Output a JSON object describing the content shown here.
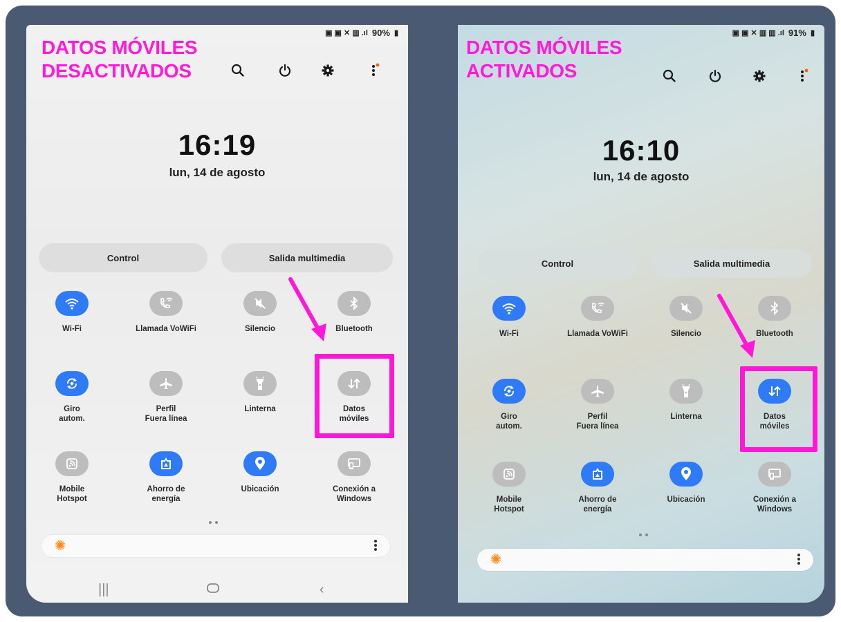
{
  "frame_color": "#4a5a73",
  "accent_color": "#ff18d6",
  "toggle_on_color": "#2f7af6",
  "toggle_off_color": "#bdbdbd",
  "left": {
    "caption_line1": "DATOS MÓVILES",
    "caption_line2": "DESACTIVADOS",
    "battery": "90%",
    "time": "16:19",
    "date": "lun, 14 de agosto",
    "control_label": "Control",
    "media_label": "Salida multimedia",
    "tiles": [
      {
        "label1": "Wi-Fi",
        "label2": "",
        "icon": "wifi-icon",
        "on": true
      },
      {
        "label1": "Llamada VoWiFi",
        "label2": "",
        "icon": "phone-wifi-icon",
        "on": false
      },
      {
        "label1": "Silencio",
        "label2": "",
        "icon": "mute-icon",
        "on": false
      },
      {
        "label1": "Bluetooth",
        "label2": "",
        "icon": "bluetooth-icon",
        "on": false
      },
      {
        "label1": "Giro",
        "label2": "autom.",
        "icon": "rotate-icon",
        "on": true
      },
      {
        "label1": "Perfil",
        "label2": "Fuera línea",
        "icon": "airplane-icon",
        "on": false
      },
      {
        "label1": "Linterna",
        "label2": "",
        "icon": "flashlight-icon",
        "on": false
      },
      {
        "label1": "Datos",
        "label2": "móviles",
        "icon": "mobile-data-icon",
        "on": false
      },
      {
        "label1": "Mobile",
        "label2": "Hotspot",
        "icon": "hotspot-icon",
        "on": false
      },
      {
        "label1": "Ahorro de",
        "label2": "energía",
        "icon": "battery-saver-icon",
        "on": true
      },
      {
        "label1": "Ubicación",
        "label2": "",
        "icon": "location-icon",
        "on": true
      },
      {
        "label1": "Conexión a",
        "label2": "Windows",
        "icon": "windows-link-icon",
        "on": false
      }
    ]
  },
  "right": {
    "caption_line1": "DATOS MÓVILES",
    "caption_line2": "ACTIVADOS",
    "battery": "91%",
    "time": "16:10",
    "date": "lun, 14 de agosto",
    "control_label": "Control",
    "media_label": "Salida multimedia",
    "tiles": [
      {
        "label1": "Wi-Fi",
        "label2": "",
        "icon": "wifi-icon",
        "on": true
      },
      {
        "label1": "Llamada VoWiFi",
        "label2": "",
        "icon": "phone-wifi-icon",
        "on": false
      },
      {
        "label1": "Silencio",
        "label2": "",
        "icon": "mute-icon",
        "on": false
      },
      {
        "label1": "Bluetooth",
        "label2": "",
        "icon": "bluetooth-icon",
        "on": false
      },
      {
        "label1": "Giro",
        "label2": "autom.",
        "icon": "rotate-icon",
        "on": true
      },
      {
        "label1": "Perfil",
        "label2": "Fuera línea",
        "icon": "airplane-icon",
        "on": false
      },
      {
        "label1": "Linterna",
        "label2": "",
        "icon": "flashlight-icon",
        "on": false
      },
      {
        "label1": "Datos",
        "label2": "móviles",
        "icon": "mobile-data-icon",
        "on": true
      },
      {
        "label1": "Mobile",
        "label2": "Hotspot",
        "icon": "hotspot-icon",
        "on": false
      },
      {
        "label1": "Ahorro de",
        "label2": "energía",
        "icon": "battery-saver-icon",
        "on": true
      },
      {
        "label1": "Ubicación",
        "label2": "",
        "icon": "location-icon",
        "on": true
      },
      {
        "label1": "Conexión a",
        "label2": "Windows",
        "icon": "windows-link-icon",
        "on": false
      }
    ]
  }
}
